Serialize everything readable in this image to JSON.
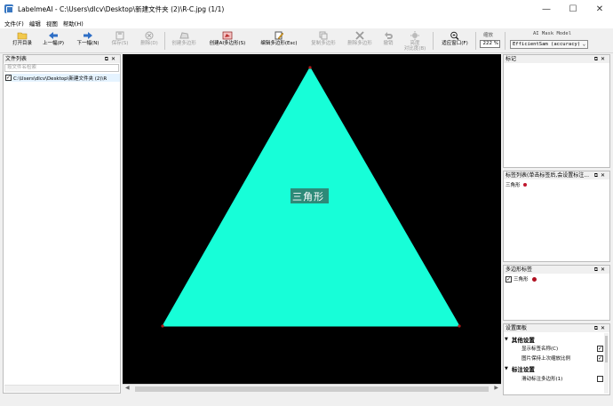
{
  "window": {
    "title": "LabelmeAI - C:\\Users\\dlcv\\Desktop\\新建文件夹 (2)\\R-C.jpg (1/1)",
    "minimize": "—",
    "maximize": "☐",
    "close": "✕"
  },
  "menu": [
    "文件(F)",
    "编辑",
    "视图",
    "帮助(H)"
  ],
  "toolbar": {
    "open_dir": "打开目录",
    "prev": "上一幅(P)",
    "next": "下一幅(N)",
    "save": "保存(S)",
    "delete": "删除(D)",
    "create_polygon": "创建多边形",
    "create_ai_polygon": "创建AI多边形(S)",
    "edit_polygon": "编辑多边形(Esc)",
    "copy_polygon": "复制多边形",
    "delete_polygon": "删除多边形",
    "undo": "撤销",
    "brightness_contrast_l1": "亮度",
    "brightness_contrast_l2": "对比度(B)",
    "fit_window": "适应窗口(F)",
    "zoom_label": "缩放",
    "zoom_value": "222 %",
    "ai_model_label": "AI Mask Model",
    "ai_model_value": "EfficientSam (accuracy)"
  },
  "file_panel": {
    "title": "文件列表",
    "search_placeholder": "按文件名检索",
    "files": [
      {
        "name": "C:\\Users\\dlcv\\Desktop\\新建文件夹 (2)\\R",
        "checked": true
      }
    ]
  },
  "canvas": {
    "shape_label": "三角形",
    "fill_color": "#17fed8",
    "background": "#000000"
  },
  "flag_panel": {
    "title": "标记"
  },
  "label_panel": {
    "title": "标签列表(单击标签后,会设置标注...",
    "items": [
      {
        "label": "三角形",
        "color": "#c0162d"
      }
    ]
  },
  "polygon_panel": {
    "title": "多边形标签",
    "items": [
      {
        "label": "三角形",
        "color": "#b01020",
        "checked": true
      }
    ]
  },
  "settings_panel": {
    "title": "设置面板",
    "groups": [
      {
        "name": "其他设置",
        "rows": [
          {
            "label": "显示标签名称(C)",
            "checked": true
          },
          {
            "label": "图片保持上次缩放比例",
            "checked": true
          }
        ]
      },
      {
        "name": "标注设置",
        "rows": [
          {
            "label": "滑动标注多边形(1)",
            "checked": false
          }
        ]
      }
    ]
  }
}
